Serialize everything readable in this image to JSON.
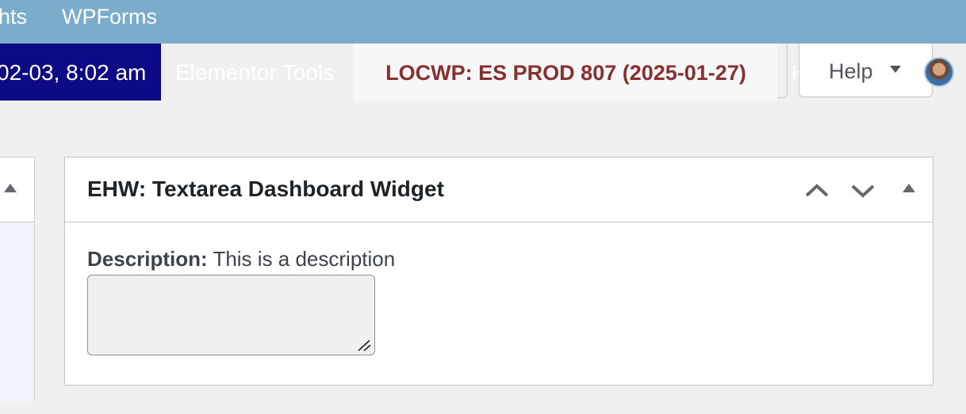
{
  "top_nav": {
    "items": [
      {
        "label": "hts"
      },
      {
        "label": "WPForms"
      }
    ]
  },
  "admin_bar": {
    "datetime": "02-03, 8:02 am",
    "elementor_tools": "Elementor Tools",
    "site_label": "LOCWP: ES PROD 807 (2025-01-27)",
    "overflow_glyph": "H"
  },
  "help": {
    "label": "Help",
    "arrow_icon": "caret-down-icon"
  },
  "avatar": {
    "icon": "user-avatar"
  },
  "left_panel": {
    "toggle_icon": "triangle-up-icon"
  },
  "widget": {
    "title": "EHW: Textarea Dashboard Widget",
    "controls": {
      "move_up_icon": "chevron-up-icon",
      "move_down_icon": "chevron-down-icon",
      "toggle_icon": "triangle-up-icon"
    },
    "description_label": "Description:",
    "description_text": " This is a description",
    "textarea_value": ""
  },
  "colors": {
    "top_nav_bg": "#7aaccb",
    "datetime_bg": "#0d0a85",
    "site_label_color": "#8a2f2f",
    "page_bg": "#f0f0f1"
  }
}
